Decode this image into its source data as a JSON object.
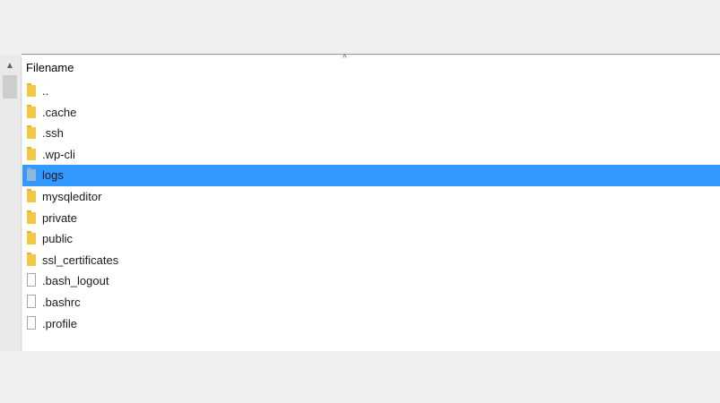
{
  "file_list": {
    "column_header": "Filename",
    "sort_indicator": "^",
    "scroll_up_arrow": "▲",
    "items": [
      {
        "name": "..",
        "type": "folder",
        "selected": false
      },
      {
        "name": ".cache",
        "type": "folder",
        "selected": false
      },
      {
        "name": ".ssh",
        "type": "folder",
        "selected": false
      },
      {
        "name": ".wp-cli",
        "type": "folder",
        "selected": false
      },
      {
        "name": "logs",
        "type": "folder",
        "selected": true
      },
      {
        "name": "mysqleditor",
        "type": "folder",
        "selected": false
      },
      {
        "name": "private",
        "type": "folder",
        "selected": false
      },
      {
        "name": "public",
        "type": "folder",
        "selected": false
      },
      {
        "name": "ssl_certificates",
        "type": "folder",
        "selected": false
      },
      {
        "name": ".bash_logout",
        "type": "file",
        "selected": false
      },
      {
        "name": ".bashrc",
        "type": "file",
        "selected": false
      },
      {
        "name": ".profile",
        "type": "file",
        "selected": false
      }
    ]
  },
  "colors": {
    "selection": "#3399ff",
    "folder": "#f2c744",
    "background": "#f0f0f0"
  }
}
